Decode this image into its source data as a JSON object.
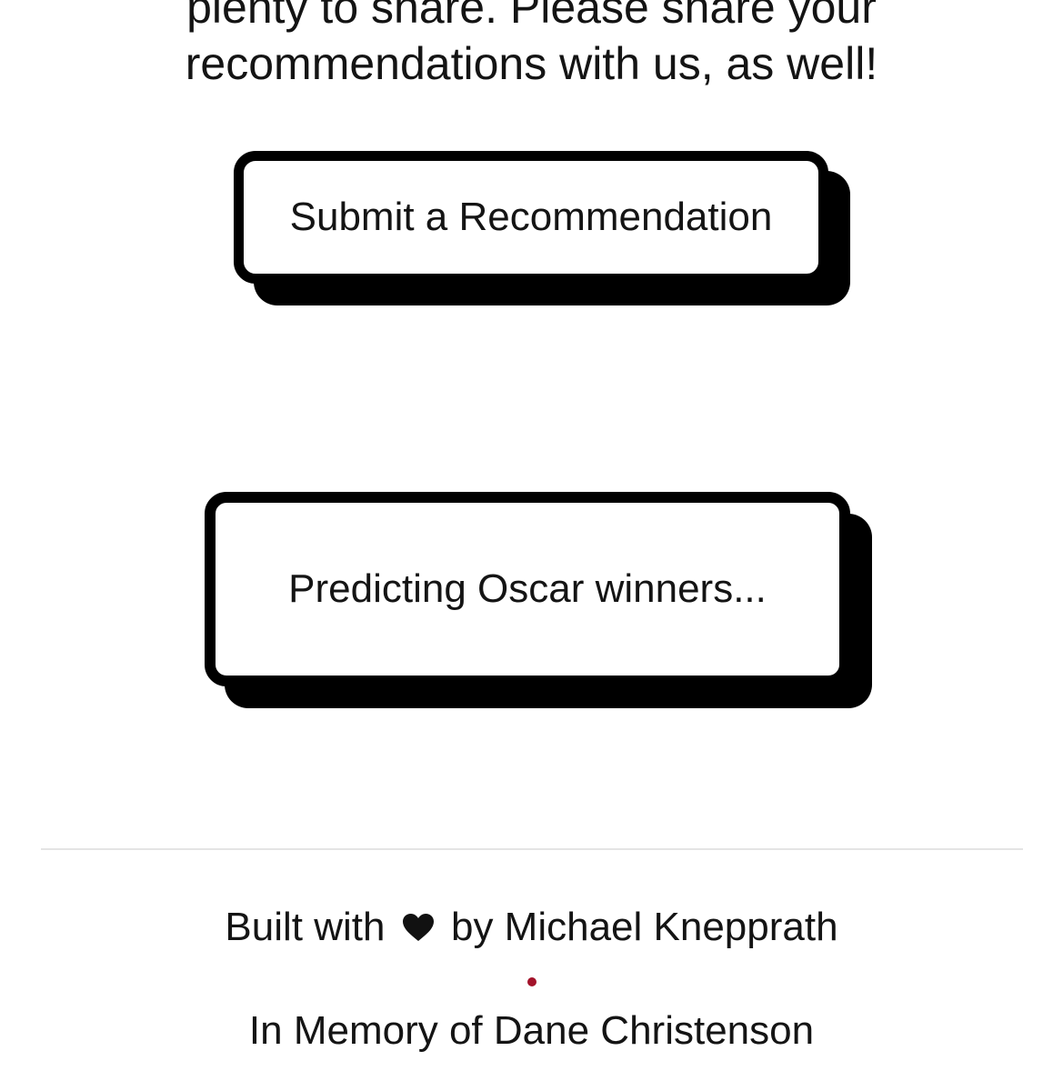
{
  "intro": {
    "line1": "plenty to share. Please share your",
    "line2": "recommendations with us, as well!"
  },
  "submit_button": {
    "label": "Submit a Recommendation"
  },
  "prediction_button": {
    "label": "Predicting Oscar winners..."
  },
  "footer": {
    "built_prefix": "Built with",
    "heart_icon": "heart-icon",
    "built_suffix": "by Michael Knepprath",
    "separator_icon": "dot-icon",
    "separator_color": "#a3132a",
    "memory": "In Memory of Dane Christenson"
  }
}
